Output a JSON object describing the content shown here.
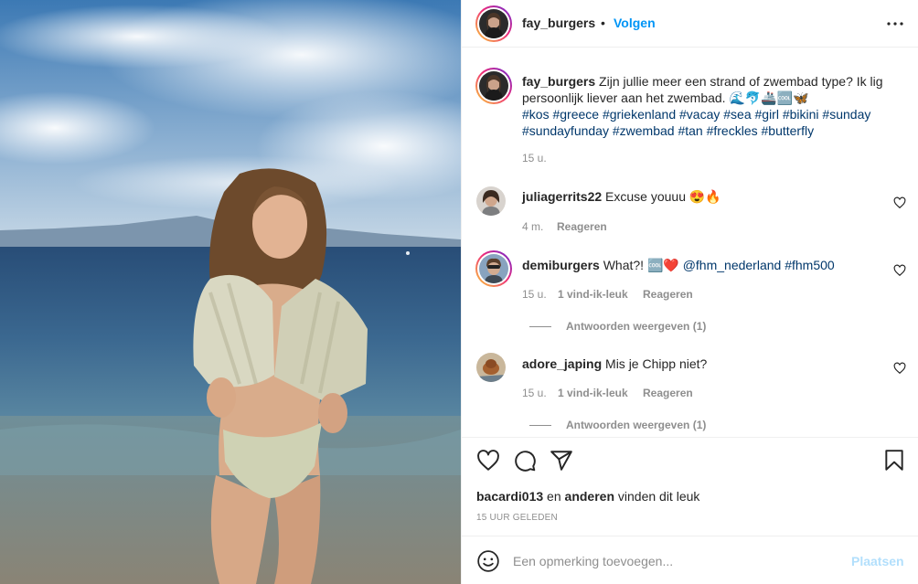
{
  "post": {
    "username": "fay_burgers",
    "dot": "•",
    "follow_label": "Volgen",
    "more_icon": "more-horizontal-icon"
  },
  "caption": {
    "username": "fay_burgers",
    "text": "Zijn jullie meer een strand of zwembad type? Ik lig persoonlijk liever aan het zwembad. 🌊🐬🚢🆒🦋",
    "hashtags": "#kos #greece #griekenland #vacay #sea #girl #bikini #sunday #sundayfunday #zwembad #tan #freckles #butterfly",
    "time": "15 u."
  },
  "comments": [
    {
      "username": "juliagerrits22",
      "text": "Excuse youuu 😍🔥",
      "time": "4 m.",
      "reply_label": "Reageren"
    },
    {
      "username": "demiburgers",
      "text": "What?! 🆒❤️",
      "mention": "@fhm_nederland #fhm500",
      "time": "15 u.",
      "likes": "1 vind-ik-leuk",
      "reply_label": "Reageren",
      "replies": "Antwoorden weergeven (1)"
    },
    {
      "username": "adore_japing",
      "text": "Mis je Chipp niet?",
      "time": "15 u.",
      "likes": "1 vind-ik-leuk",
      "reply_label": "Reageren",
      "replies": "Antwoorden weergeven (1)"
    }
  ],
  "likes": {
    "user": "bacardi013",
    "and": " en ",
    "others": "anderen",
    "suffix": " vinden dit leuk"
  },
  "posted": "15 uur geleden",
  "add_comment": {
    "placeholder": "Een opmerking toevoegen...",
    "post_label": "Plaatsen"
  },
  "colors": {
    "accent": "#0095f6",
    "hashtag": "#00376b",
    "muted": "#8e8e8e"
  }
}
